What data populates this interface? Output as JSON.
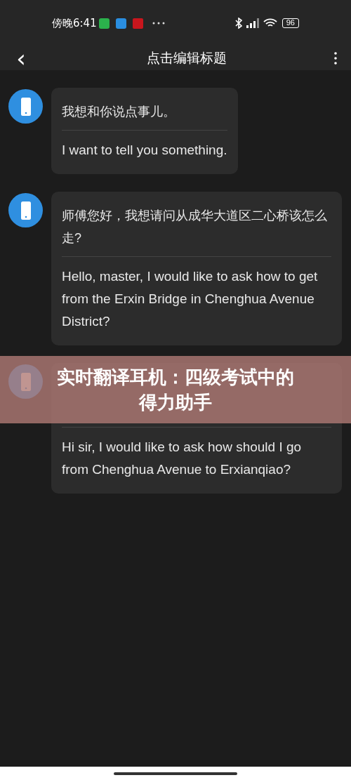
{
  "status_bar": {
    "time": "傍晚6:41",
    "battery": "96"
  },
  "header": {
    "back": "‹",
    "title": "点击编辑标题"
  },
  "messages": [
    {
      "original": "我想和你说点事儿。",
      "translation": "I want to tell you something."
    },
    {
      "original": "师傅您好，我想请问从成华大道区二心桥该怎么走?",
      "translation": "Hello, master, I would like to ask how to get from the Erxin Bridge in Chenghua Avenue District?"
    },
    {
      "translation": "Hi sir, I would like to ask how should I go from Chenghua Avenue to Erxianqiao?"
    }
  ],
  "banner": {
    "title": "实时翻译耳机：四级考试中的得力助手"
  }
}
